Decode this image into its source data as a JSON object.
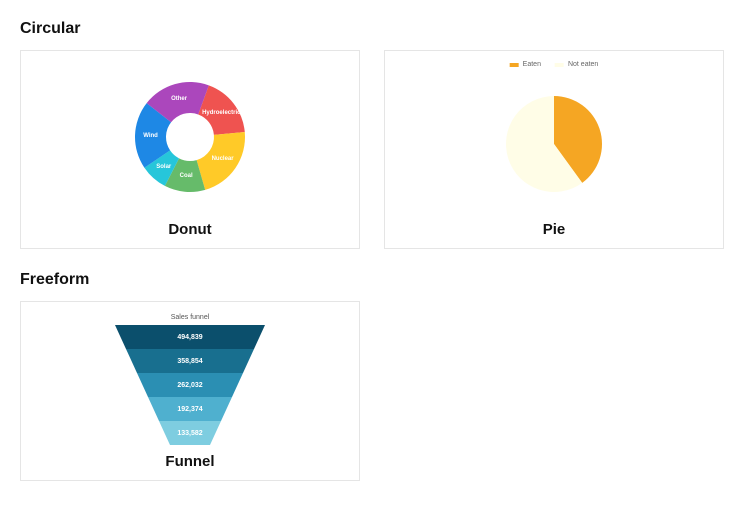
{
  "sections": {
    "circular_title": "Circular",
    "freeform_title": "Freeform"
  },
  "cards": {
    "donut_title": "Donut",
    "pie_title": "Pie",
    "funnel_title": "Funnel"
  },
  "chart_data": [
    {
      "id": "donut",
      "type": "pie",
      "donut": true,
      "title": "",
      "series": [
        {
          "name": "Hydroelectric",
          "value": 18,
          "color": "#ef5350"
        },
        {
          "name": "Nuclear",
          "value": 22,
          "color": "#ffca28"
        },
        {
          "name": "Coal",
          "value": 12,
          "color": "#66bb6a"
        },
        {
          "name": "Solar",
          "value": 8,
          "color": "#26c6da"
        },
        {
          "name": "Wind",
          "value": 20,
          "color": "#1e88e5"
        },
        {
          "name": "Other",
          "value": 20,
          "color": "#ab47bc"
        }
      ]
    },
    {
      "id": "pie",
      "type": "pie",
      "donut": false,
      "title": "",
      "legend": [
        {
          "name": "Eaten",
          "color": "#f5a623"
        },
        {
          "name": "Not eaten",
          "color": "#fffde7"
        }
      ],
      "series": [
        {
          "name": "Eaten",
          "value": 40,
          "color": "#f5a623"
        },
        {
          "name": "Not eaten",
          "value": 60,
          "color": "#fffde7"
        }
      ]
    },
    {
      "id": "funnel",
      "type": "funnel",
      "title": "Sales funnel",
      "series": [
        {
          "label": "494,839",
          "value": 494839,
          "color": "#0b4f6c"
        },
        {
          "label": "358,854",
          "value": 358854,
          "color": "#186f8f"
        },
        {
          "label": "262,032",
          "value": 262032,
          "color": "#2b8fb3"
        },
        {
          "label": "192,374",
          "value": 192374,
          "color": "#4fb0cf"
        },
        {
          "label": "133,582",
          "value": 133582,
          "color": "#7ecde0"
        }
      ]
    }
  ]
}
